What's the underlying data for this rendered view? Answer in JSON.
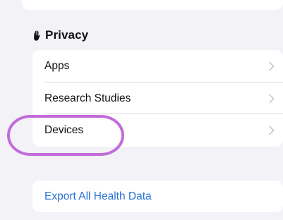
{
  "privacy": {
    "icon": "raised-hand-icon",
    "title": "Privacy",
    "items": [
      {
        "label": "Apps",
        "icon": "chevron-right-icon"
      },
      {
        "label": "Research Studies",
        "icon": "chevron-right-icon"
      },
      {
        "label": "Devices",
        "icon": "chevron-right-icon"
      }
    ]
  },
  "export": {
    "label": "Export All Health Data"
  },
  "colors": {
    "background": "#f2f2f7",
    "card": "#ffffff",
    "link": "#2a72d6",
    "chevron": "#c4c4c9",
    "highlight": "#c26cd9"
  }
}
